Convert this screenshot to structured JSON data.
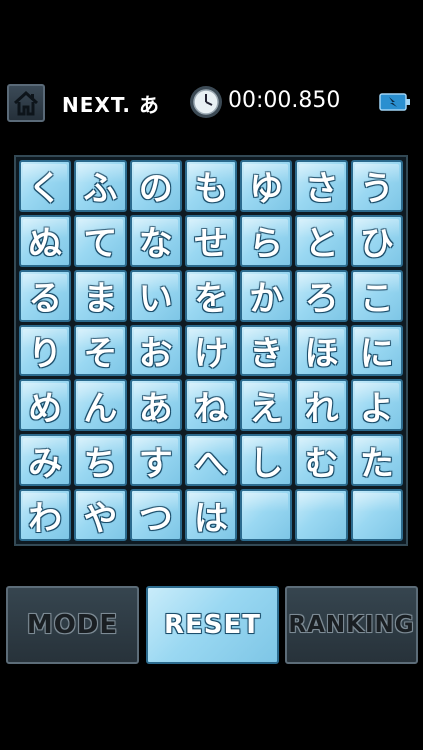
{
  "header": {
    "next_label": "NEXT.",
    "next_char": "あ",
    "timer": "00:00.850",
    "home_icon": "home-icon",
    "clock_icon": "clock-icon",
    "battery_icon": "battery-icon"
  },
  "board": {
    "tiles": [
      "く",
      "ふ",
      "の",
      "も",
      "ゆ",
      "さ",
      "う",
      "ぬ",
      "て",
      "な",
      "せ",
      "ら",
      "と",
      "ひ",
      "る",
      "ま",
      "い",
      "を",
      "か",
      "ろ",
      "こ",
      "り",
      "そ",
      "お",
      "け",
      "き",
      "ほ",
      "に",
      "め",
      "ん",
      "あ",
      "ね",
      "え",
      "れ",
      "よ",
      "み",
      "ち",
      "す",
      "へ",
      "し",
      "む",
      "た",
      "わ",
      "や",
      "つ",
      "は",
      "",
      "",
      ""
    ]
  },
  "buttons": {
    "mode": "MODE",
    "reset": "RESET",
    "ranking": "RANKING"
  },
  "colors": {
    "tile": "#9ad8f2",
    "tile_border": "#2c6b8e",
    "disabled_button": "#36454f",
    "background": "#000000"
  }
}
